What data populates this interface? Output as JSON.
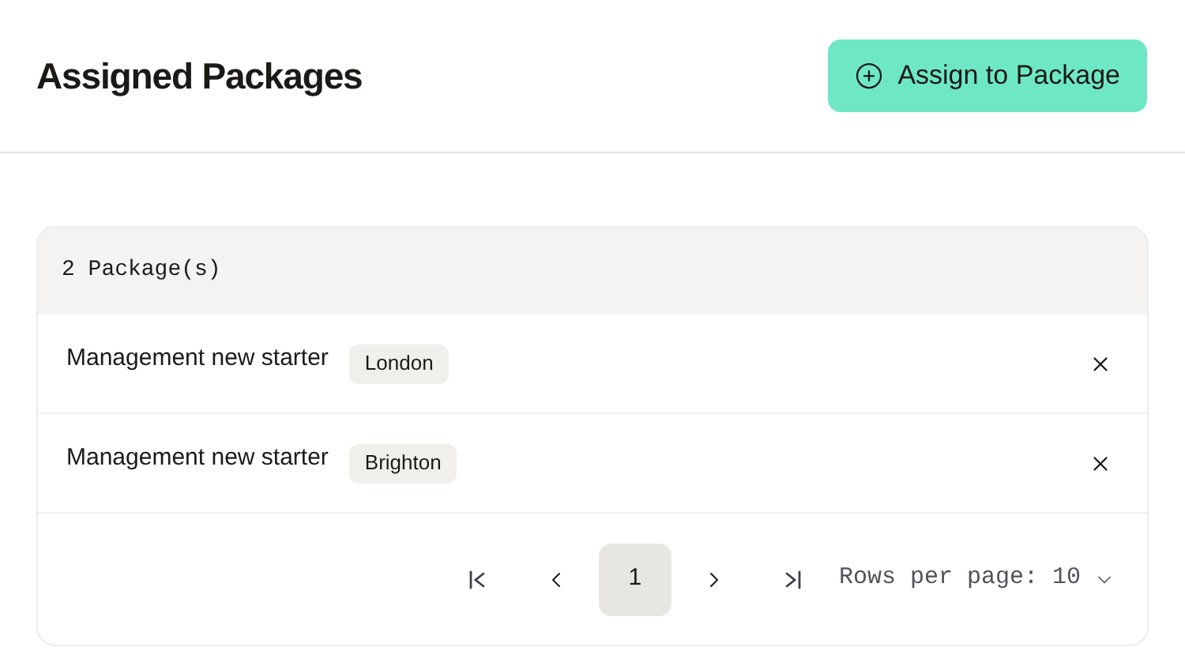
{
  "header": {
    "title": "Assigned Packages",
    "button": "Assign to Package"
  },
  "table": {
    "count": "2 Package(s)",
    "rows": [
      {
        "name": "Management new starter",
        "tag": "London"
      },
      {
        "name": "Management new starter",
        "tag": "Brighton"
      }
    ]
  },
  "pagination": {
    "pages": [
      {
        "label": "1",
        "selected": true
      }
    ],
    "rows_per_page": "Rows per page: 10"
  }
}
